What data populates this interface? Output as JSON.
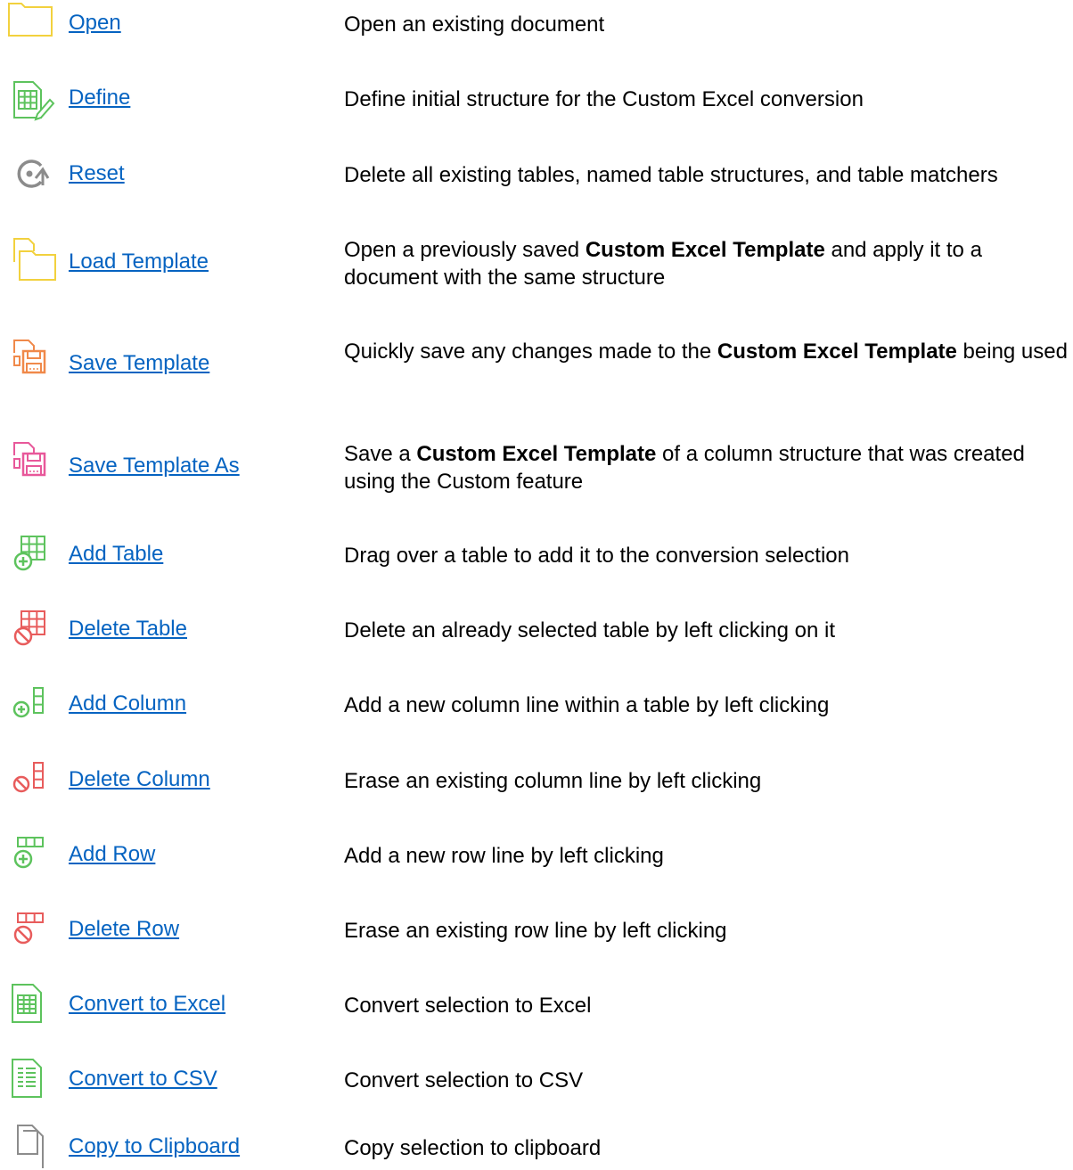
{
  "colors": {
    "link": "#0563c1",
    "folder_yellow": "#f2d13e",
    "green": "#5dc35d",
    "orange": "#f0894a",
    "pink": "#e8589a",
    "red": "#e85c5c",
    "gray": "#8c8c8c"
  },
  "items": [
    {
      "icon": "folder-icon",
      "label": "Open",
      "desc": [
        {
          "t": "Open an existing document"
        }
      ]
    },
    {
      "icon": "define-table-icon",
      "label": "Define",
      "desc": [
        {
          "t": "Define initial structure for the Custom Excel conversion"
        }
      ]
    },
    {
      "icon": "reset-icon",
      "label": "Reset",
      "desc": [
        {
          "t": "Delete all existing tables, named table structures, and table matchers"
        }
      ]
    },
    {
      "icon": "load-template-icon",
      "label": "Load Template",
      "desc": [
        {
          "t": "Open a previously saved "
        },
        {
          "t": "Custom Excel Template",
          "b": true
        },
        {
          "t": " and apply it to a document with the same structure"
        }
      ]
    },
    {
      "icon": "save-template-icon",
      "label": "Save Template",
      "desc": [
        {
          "t": "Quickly save any changes made to the "
        },
        {
          "t": "Custom Excel Template",
          "b": true
        },
        {
          "t": " being used"
        }
      ]
    },
    {
      "icon": "save-template-as-icon",
      "label": "Save Template As",
      "desc": [
        {
          "t": "Save a "
        },
        {
          "t": "Custom Excel Template",
          "b": true
        },
        {
          "t": " of a column structure that was created using the Custom feature"
        }
      ]
    },
    {
      "icon": "add-table-icon",
      "label": "Add Table",
      "desc": [
        {
          "t": "Drag over a table to add it to the conversion selection"
        }
      ]
    },
    {
      "icon": "delete-table-icon",
      "label": "Delete Table",
      "desc": [
        {
          "t": "Delete an already selected table by left clicking on it"
        }
      ]
    },
    {
      "icon": "add-column-icon",
      "label": "Add Column",
      "desc": [
        {
          "t": "Add a new column line within a table by left clicking"
        }
      ]
    },
    {
      "icon": "delete-column-icon",
      "label": "Delete Column",
      "desc": [
        {
          "t": "Erase an existing column line by left clicking"
        }
      ]
    },
    {
      "icon": "add-row-icon",
      "label": "Add Row",
      "desc": [
        {
          "t": "Add a new row line by left clicking"
        }
      ]
    },
    {
      "icon": "delete-row-icon",
      "label": "Delete Row",
      "desc": [
        {
          "t": "Erase an existing row line by left clicking"
        }
      ]
    },
    {
      "icon": "excel-file-icon",
      "label": "Convert to Excel",
      "desc": [
        {
          "t": "Convert selection to Excel"
        }
      ]
    },
    {
      "icon": "csv-file-icon",
      "label": "Convert to CSV",
      "desc": [
        {
          "t": "Convert selection to CSV"
        }
      ]
    },
    {
      "icon": "copy-icon",
      "label": "Copy to Clipboard",
      "desc": [
        {
          "t": "Copy selection to clipboard"
        }
      ]
    }
  ]
}
